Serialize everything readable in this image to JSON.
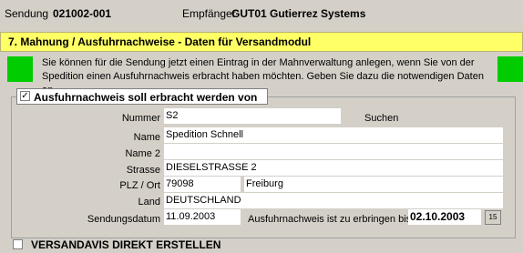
{
  "header": {
    "sendung_label": "Sendung",
    "sendung_value": "021002-001",
    "empfaenger_label": "Empfänger",
    "empfaenger_value": "GUT01 Gutierrez Systems"
  },
  "section_title": "7. Mahnung / Ausfuhrnachweise - Daten für Versandmodul",
  "info_text": "Sie können für die Sendung jetzt einen Eintrag in der Mahnverwaltung anlegen, wenn Sie von der Spedition einen  Ausfuhrnachweis erbracht haben möchten.  Geben Sie dazu die notwendigen Daten an.",
  "group": {
    "checkbox_label": "Ausfuhrnachweis soll erbracht werden von",
    "checked": true
  },
  "form": {
    "nummer_label": "Nummer",
    "nummer_value": "S2",
    "suchen_label": "Suchen",
    "name_label": "Name",
    "name_value": "Spedition Schnell",
    "name2_label": "Name 2",
    "name2_value": "",
    "strasse_label": "Strasse",
    "strasse_value": "DIESELSTRASSE 2",
    "plz_ort_label": "PLZ / Ort",
    "plz_value": "79098",
    "ort_value": "Freiburg",
    "land_label": "Land",
    "land_value": "DEUTSCHLAND",
    "sendungsdatum_label": "Sendungsdatum",
    "sendungsdatum_value": "11.09.2003",
    "ausfuhr_label": "Ausfuhrnachweis ist zu erbringen bis",
    "ausfuhr_value": "02.10.2003",
    "calendar_glyph": "15"
  },
  "versandavis": {
    "label": "VERSANDAVIS DIREKT ERSTELLEN",
    "checked": false
  }
}
